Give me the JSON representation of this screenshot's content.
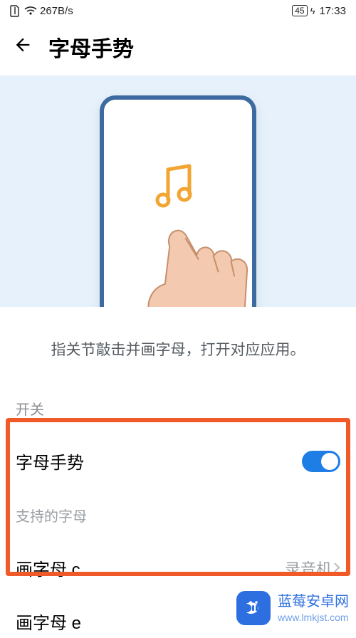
{
  "status": {
    "net_speed": "267B/s",
    "battery": "45",
    "time": "17:33"
  },
  "nav": {
    "title": "字母手势"
  },
  "hero": {
    "desc": "指关节敲击并画字母，打开对应应用。"
  },
  "section_switch_label": "开关",
  "row_toggle": {
    "label": "字母手势",
    "on": true
  },
  "section_letters_label": "支持的字母",
  "rows": [
    {
      "label": "画字母 c",
      "value": "录音机"
    },
    {
      "label": "画字母 e",
      "value": ""
    }
  ],
  "watermark": {
    "line1": "蓝莓安卓网",
    "line2": "www.lmkjst.com"
  }
}
